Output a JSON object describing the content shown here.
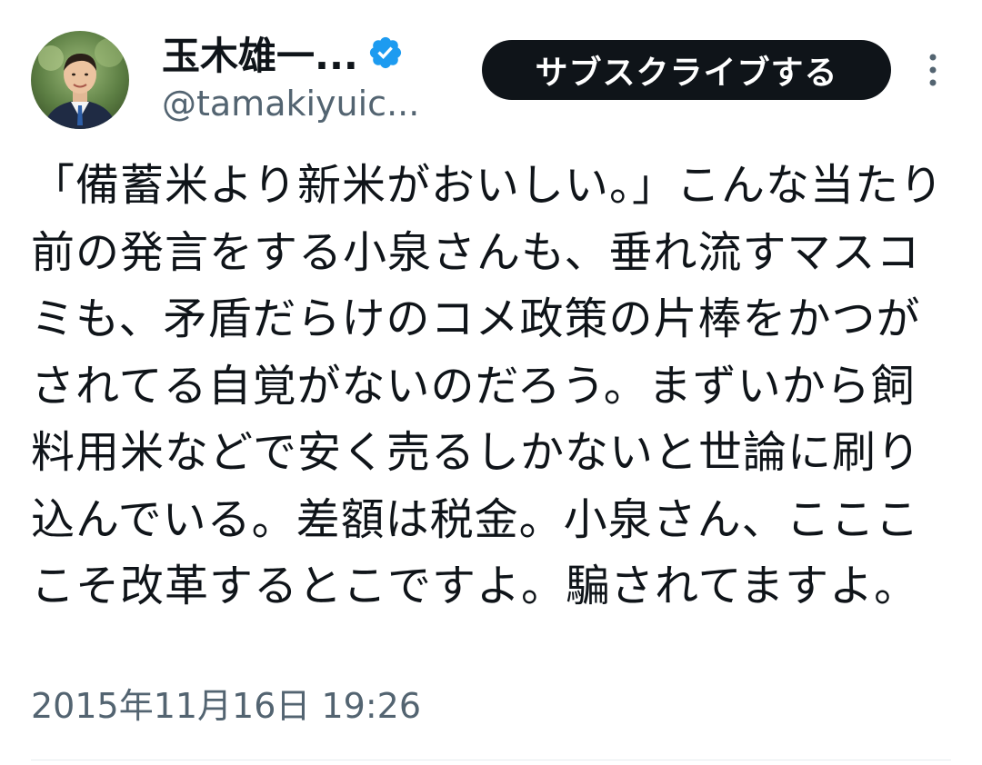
{
  "author": {
    "display_name": "玉木雄一...",
    "handle": "@tamakiyuic...",
    "verified_badge_color": "#1d9bf0"
  },
  "actions": {
    "subscribe_label": "サブスクライブする",
    "more_icon": "more-vertical-icon"
  },
  "tweet": {
    "text": "「備蓄米より新米がおいしい。」こんな当たり前の発言をする小泉さんも、垂れ流すマスコミも、矛盾だらけのコメ政策の片棒をかつがされてる自覚がないのだろう。まずいから飼料用米などで安く売るしかないと世論に刷り込んでいる。差額は税金。小泉さん、ここここそ改革するとこですよ。騙されてますよ。",
    "timestamp": "2015年11月16日 19:26"
  },
  "colors": {
    "text_primary": "#0f1419",
    "text_secondary": "#536471",
    "button_bg": "#0f1419",
    "button_text": "#ffffff"
  }
}
